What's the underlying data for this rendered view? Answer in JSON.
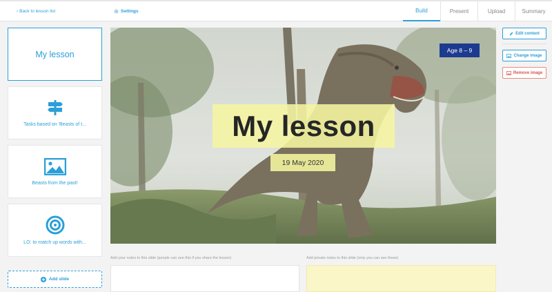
{
  "topbar": {
    "back_label": "Back to lesson list",
    "settings_label": "Settings",
    "tabs": [
      {
        "label": "Build",
        "active": true
      },
      {
        "label": "Present",
        "active": false
      },
      {
        "label": "Upload",
        "active": false
      },
      {
        "label": "Summary",
        "active": false
      }
    ]
  },
  "slides": [
    {
      "label": "My lesson",
      "type": "title",
      "selected": true
    },
    {
      "label": "Tasks based on 'Beasts of t...",
      "icon": "signpost-icon"
    },
    {
      "label": "Beasts from the past!",
      "icon": "image-icon"
    },
    {
      "label": "LO: to match up words with...",
      "icon": "target-icon"
    }
  ],
  "add_slide_label": "Add slide",
  "current_slide": {
    "title": "My lesson",
    "date": "19 May 2020",
    "age_badge": "Age 8 – 9"
  },
  "actions": {
    "edit_content": "Edit content",
    "change_image": "Change image",
    "remove_image": "Remove image"
  },
  "notes": {
    "public_label": "Add your notes to this slide (people can see this if you share the lesson)",
    "private_label": "Add private notes to this slide (only you can see these)"
  },
  "colors": {
    "accent": "#2a9fd8",
    "badge": "#1c3a8f",
    "title_highlight": "#f5f5a0",
    "danger": "#d9534f",
    "private_notes_bg": "#fbf6c8"
  }
}
